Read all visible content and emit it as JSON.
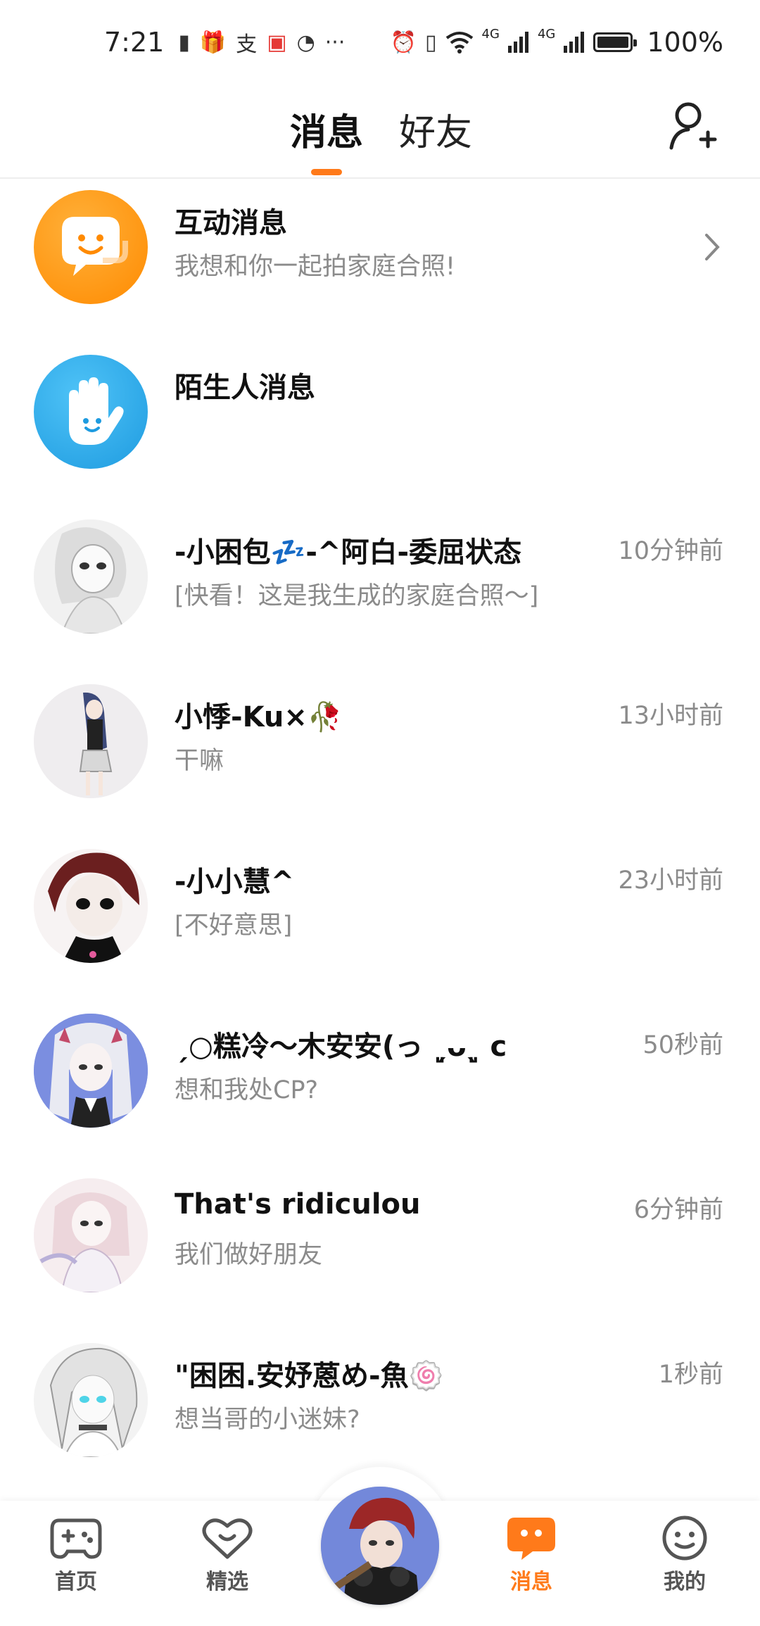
{
  "status_bar": {
    "time": "7:21",
    "network_1": "4G",
    "network_2": "4G",
    "battery": "100%"
  },
  "header": {
    "tab_messages": "消息",
    "tab_friends": "好友",
    "accent_color": "#ff7a1a"
  },
  "conversations": [
    {
      "title": "互动消息",
      "preview": "我想和你一起拍家庭合照!",
      "time": ""
    },
    {
      "title": "陌生人消息",
      "preview": "",
      "time": ""
    },
    {
      "title": "-小困包💤-^阿白-委屈状态",
      "preview": "[快看！这是我生成的家庭合照～]",
      "time": "10分钟前"
    },
    {
      "title": "小悸-Ku×🥀",
      "preview": "干嘛",
      "time": "13小时前"
    },
    {
      "title": "-小小慧^",
      "preview": "[不好意思]",
      "time": "23小时前"
    },
    {
      "title": "ˏ○糕冷～木安安(っ ˏ͈ᴗˎ͈ c",
      "preview": "想和我处CP?",
      "time": "50秒前"
    },
    {
      "title": "That's ridiculou",
      "preview": "我们做好朋友",
      "time": "6分钟前"
    },
    {
      "title": "\"困困.安妤蒽め-魚🍥",
      "preview": "想当哥的小迷妹?",
      "time": "1秒前"
    }
  ],
  "bottom_nav": {
    "home": "首页",
    "featured": "精选",
    "messages": "消息",
    "me": "我的"
  }
}
